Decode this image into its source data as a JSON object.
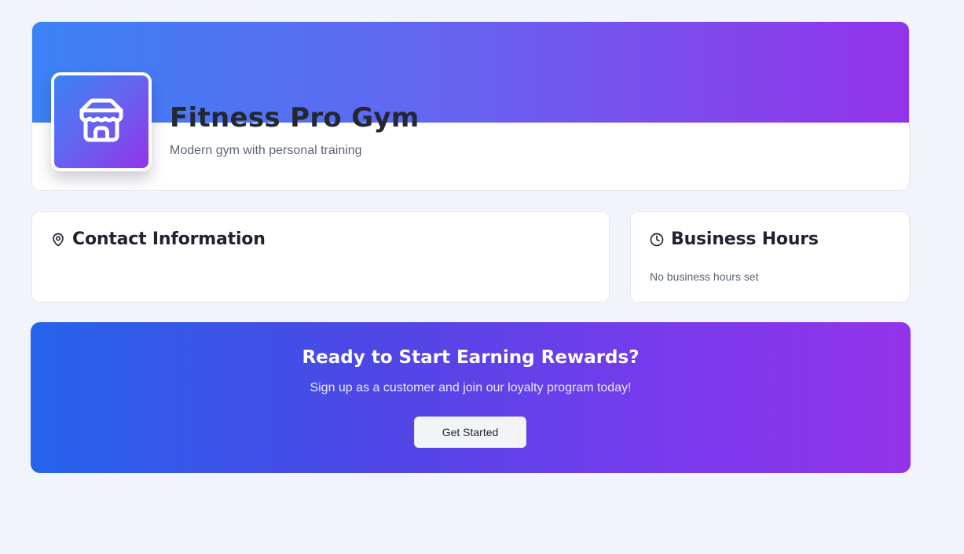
{
  "business": {
    "name": "Fitness Pro Gym",
    "tagline": "Modern gym with personal training",
    "logo_icon": "storefront-icon"
  },
  "contact": {
    "title": "Contact Information",
    "icon": "map-pin-icon"
  },
  "hours": {
    "title": "Business Hours",
    "icon": "clock-icon",
    "empty_text": "No business hours set"
  },
  "cta": {
    "title": "Ready to Start Earning Rewards?",
    "subtitle": "Sign up as a customer and join our loyalty program today!",
    "button_label": "Get Started"
  },
  "colors": {
    "gradient_start": "#3b82f6",
    "gradient_mid": "#6366f1",
    "gradient_end": "#9333ea",
    "page_background": "#f2f4fb"
  }
}
